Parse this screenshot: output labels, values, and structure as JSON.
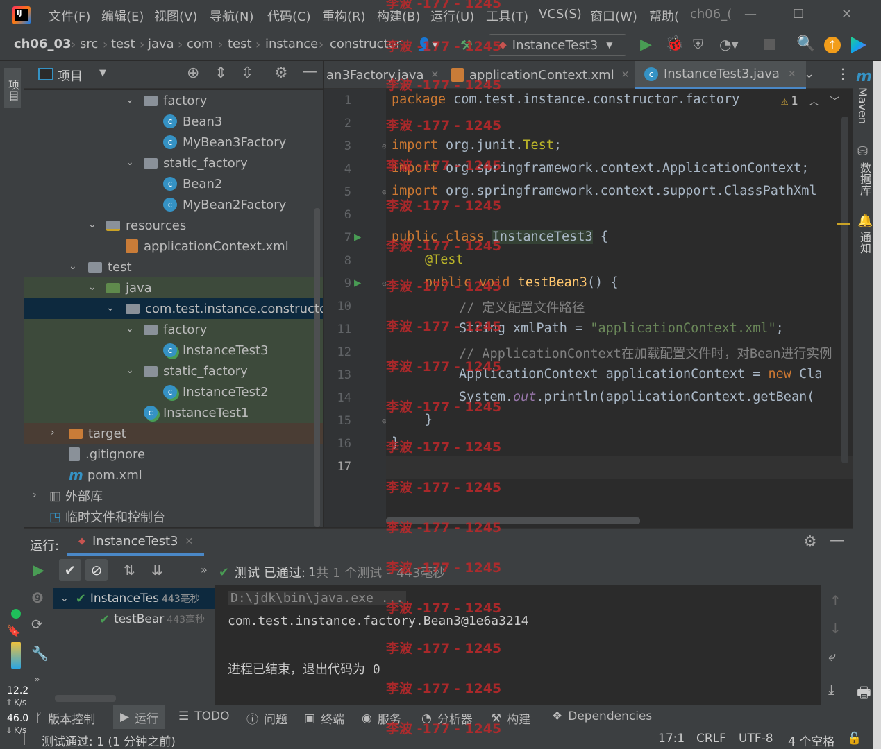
{
  "titlebar": {
    "menus": [
      "文件(F)",
      "编辑(E)",
      "视图(V)",
      "导航(N)",
      "代码(C)",
      "重构(R)",
      "构建(B)",
      "运行(U)",
      "工具(T)",
      "VCS(S)",
      "窗口(W)",
      "帮助("
    ],
    "window_title": "ch06_(",
    "minimize": "—",
    "maximize": "☐",
    "close": "✕"
  },
  "breadcrumb": {
    "items": [
      "ch06_03",
      "src",
      "test",
      "java",
      "com",
      "test",
      "instance",
      "constructor"
    ],
    "run_config": "InstanceTest3"
  },
  "project_panel": {
    "title": "项目",
    "tree": [
      {
        "label": "factory",
        "kind": "folder",
        "state": "open"
      },
      {
        "label": "Bean3",
        "kind": "class"
      },
      {
        "label": "MyBean3Factory",
        "kind": "class"
      },
      {
        "label": "static_factory",
        "kind": "folder",
        "state": "open"
      },
      {
        "label": "Bean2",
        "kind": "class"
      },
      {
        "label": "MyBean2Factory",
        "kind": "class"
      },
      {
        "label": "resources",
        "kind": "resources-folder",
        "state": "open"
      },
      {
        "label": "applicationContext.xml",
        "kind": "xml"
      },
      {
        "label": "test",
        "kind": "folder",
        "state": "open"
      },
      {
        "label": "java",
        "kind": "test-folder",
        "state": "open"
      },
      {
        "label": "com.test.instance.constructor",
        "kind": "package",
        "state": "open"
      },
      {
        "label": "factory",
        "kind": "folder",
        "state": "open"
      },
      {
        "label": "InstanceTest3",
        "kind": "test-class"
      },
      {
        "label": "static_factory",
        "kind": "folder",
        "state": "open"
      },
      {
        "label": "InstanceTest2",
        "kind": "test-class"
      },
      {
        "label": "InstanceTest1",
        "kind": "test-class"
      },
      {
        "label": "target",
        "kind": "excluded-folder",
        "state": "closed"
      },
      {
        "label": ".gitignore",
        "kind": "file"
      },
      {
        "label": "pom.xml",
        "kind": "maven"
      },
      {
        "label": "外部库",
        "kind": "libraries",
        "state": "closed"
      },
      {
        "label": "临时文件和控制台",
        "kind": "scratches"
      }
    ]
  },
  "editor_tabs": [
    {
      "label": "an3Factory.java",
      "active": false
    },
    {
      "label": "applicationContext.xml",
      "active": false
    },
    {
      "label": "InstanceTest3.java",
      "active": true
    }
  ],
  "editor": {
    "warning_count": "1",
    "line_numbers": [
      "1",
      "2",
      "3",
      "4",
      "5",
      "6",
      "7",
      "8",
      "9",
      "10",
      "11",
      "12",
      "13",
      "14",
      "15",
      "16",
      "17"
    ],
    "lines": {
      "l1_kw": "package",
      "l1_rest": " com.test.instance.constructor.factory",
      "l3_kw": "import",
      "l3_rest": " org.junit.",
      "l3_ann": "Test",
      "l3_end": ";",
      "l4_kw": "import",
      "l4_rest": " org.springframework.context.ApplicationContext;",
      "l5_kw": "import",
      "l5_rest": " org.springframework.context.support.ClassPathXml",
      "l7_kw1": "public",
      "l7_kw2": " class ",
      "l7_name": "InstanceTest3",
      "l7_end": " {",
      "l8_ann": "@Test",
      "l9_kw1": "public",
      "l9_kw2": " void ",
      "l9_fn": "testBean3",
      "l9_end": "() {",
      "l10_cm": "// 定义配置文件路径",
      "l11_a": "String xmlPath = ",
      "l11_str": "\"applicationContext.xml\"",
      "l11_end": ";",
      "l12_cm": "// ApplicationContext在加载配置文件时，对Bean进行实例",
      "l13_a": "ApplicationContext applicationContext = ",
      "l13_kw": "new",
      "l13_end": " Cla",
      "l14_a": "System.",
      "l14_fld": "out",
      "l14_end": ".println(applicationContext.getBean(",
      "l15": "}",
      "l16": "}"
    }
  },
  "right_tools": {
    "maven": "Maven",
    "database": "数据库",
    "notifications": "通知"
  },
  "left_tools": {
    "project": "项目"
  },
  "run_panel": {
    "label": "运行:",
    "tab": "InstanceTest3",
    "status_pass": "测试 已通过:",
    "status_count": "1",
    "status_total": "共 1 个测试",
    "status_time": "– 443毫秒",
    "tree": [
      {
        "label": "InstanceTes",
        "time": "443毫秒"
      },
      {
        "label": "testBear",
        "time": "443毫秒"
      }
    ],
    "console": [
      "D:\\jdk\\bin\\java.exe ...",
      "com.test.instance.factory.Bean3@1e6a3214",
      "",
      "进程已结束，退出代码为 0"
    ]
  },
  "bottom_tabs": [
    "版本控制",
    "运行",
    "TODO",
    "问题",
    "终端",
    "服务",
    "分析器",
    "构建",
    "Dependencies"
  ],
  "status": {
    "message": "测试通过: 1 (1 分钟之前)",
    "position": "17:1",
    "line_sep": "CRLF",
    "encoding": "UTF-8",
    "indent": "4 个空格"
  },
  "netmon": {
    "up": "12.2",
    "up_unit": "K/s",
    "down": "46.0",
    "down_unit": "K/s"
  },
  "watermark": "李波 -177 - 1245",
  "colors": {
    "bg": "#2b2b2b",
    "panel": "#3c3f41",
    "keyword": "#cc7832",
    "string": "#6a8759",
    "annotation": "#bbb529",
    "selection": "#0d293e",
    "test_green": "#499c54"
  }
}
